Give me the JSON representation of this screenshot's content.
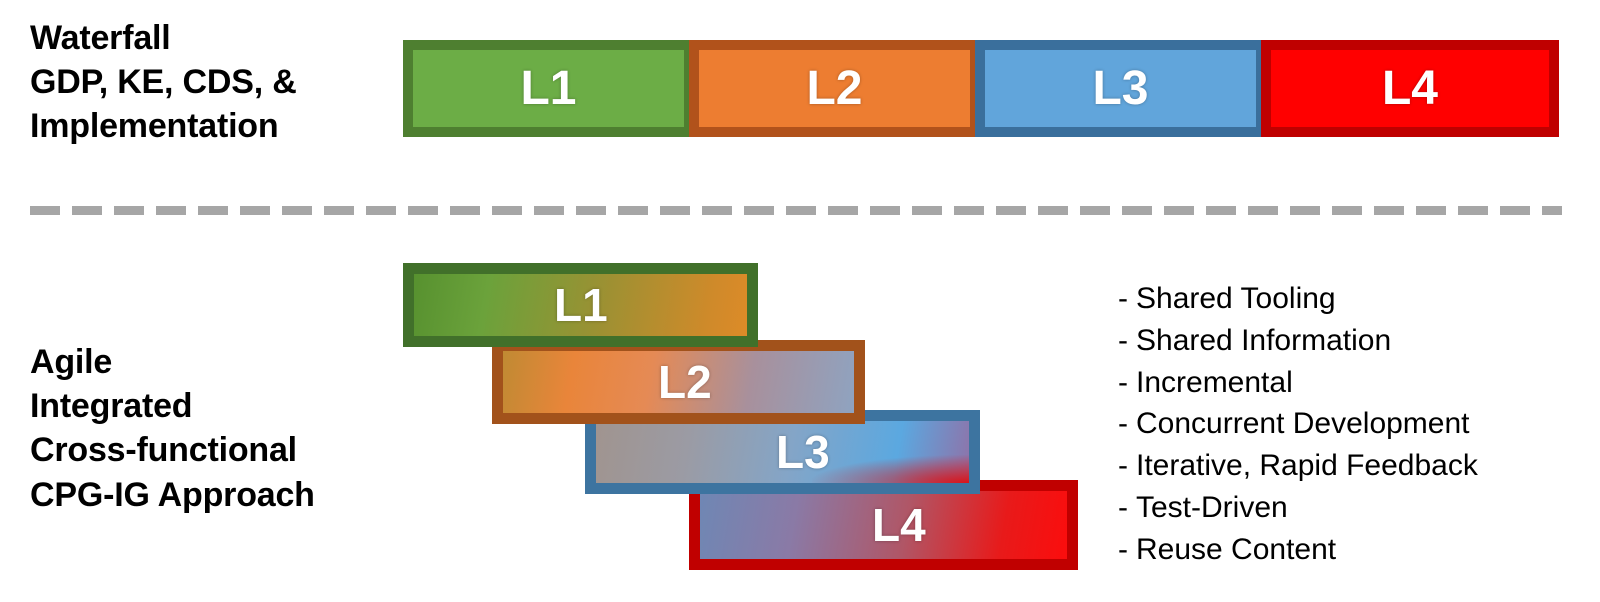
{
  "waterfall": {
    "caption": "Waterfall\nGDP, KE, CDS, &\nImplementation",
    "bars": [
      {
        "label": "L1",
        "fill": "#6cad46",
        "border": "#4e7f30"
      },
      {
        "label": "L2",
        "fill": "#ed7d31",
        "border": "#b1521b"
      },
      {
        "label": "L3",
        "fill": "#61a5db",
        "border": "#3a6f9c"
      },
      {
        "label": "L4",
        "fill": "#ff0000",
        "border": "#bf0000"
      }
    ]
  },
  "divider": {
    "color": "#a6a6a6",
    "style": "dashed"
  },
  "agile": {
    "caption": "Agile\nIntegrated\nCross-functional\nCPG-IG Approach",
    "bars": [
      {
        "label": "L1",
        "border": "#41702a",
        "gradient_from": "#57912f",
        "gradient_to": "#dd8b28"
      },
      {
        "label": "L2",
        "border": "#a2521b",
        "gradient_from": "#c08a33",
        "gradient_to": "#8fa3c0"
      },
      {
        "label": "L3",
        "border": "#3d74a0",
        "gradient_from": "#a0948f",
        "gradient_to": "#5ba8e0"
      },
      {
        "label": "L4",
        "border": "#c00000",
        "gradient_from": "#6f87b4",
        "gradient_to": "#fb0d0d"
      }
    ],
    "bullets": [
      {
        "dash": "-",
        "text": "Shared Tooling"
      },
      {
        "dash": "-",
        "text": "Shared Information"
      },
      {
        "dash": "-",
        "text": "Incremental"
      },
      {
        "dash": "-",
        "text": "Concurrent Development"
      },
      {
        "dash": "-",
        "text": "Iterative, Rapid Feedback"
      },
      {
        "dash": "-",
        "text": "Test-Driven"
      },
      {
        "dash": "-",
        "text": "Reuse Content"
      }
    ]
  }
}
